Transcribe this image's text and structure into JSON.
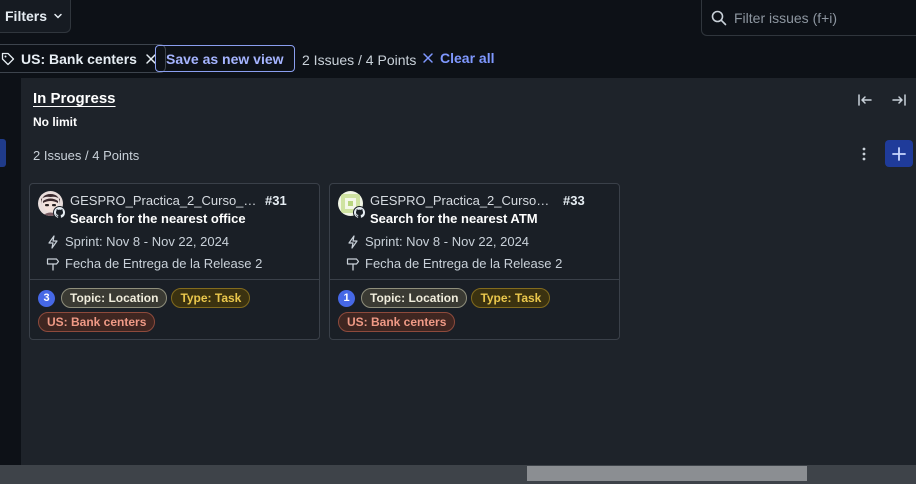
{
  "toolbar": {
    "filters_label": "Filters",
    "search_placeholder": "Filter issues (f+i)"
  },
  "filter_bar": {
    "active_filter_label": "US: Bank centers",
    "save_view_label": "Save as new view",
    "count_text": "2 Issues / 4 Points",
    "clear_all_label": "Clear all"
  },
  "column": {
    "title": "In Progress",
    "limit": "No limit",
    "count_text": "2 Issues / 4 Points"
  },
  "cards": [
    {
      "repo": "GESPRO_Practica_2_Curso_202...",
      "number": "#31",
      "title": "Search for the nearest office",
      "sprint": "Sprint: Nov 8 - Nov 22, 2024",
      "milestone": "Fecha de Entrega de la Release 2",
      "points": "3",
      "labels": [
        "Topic: Location",
        "Type: Task",
        "US: Bank centers"
      ]
    },
    {
      "repo": "GESPRO_Practica_2_Curso_20...",
      "number": "#33",
      "title": "Search for the nearest ATM",
      "sprint": "Sprint: Nov 8 - Nov 22, 2024",
      "milestone": "Fecha de Entrega de la Release 2",
      "points": "1",
      "labels": [
        "Topic: Location",
        "Type: Task",
        "US: Bank centers"
      ]
    }
  ],
  "icons": {
    "filters": "chevron-down-icon",
    "search": "search-icon",
    "filter_tag": "tag-icon",
    "remove_filter": "close-icon",
    "clear_all": "close-icon",
    "collapse_left": "collapse-left-icon",
    "collapse_right": "collapse-right-icon",
    "column_menu": "kebab-icon",
    "add_item": "plus-icon",
    "sprint": "lightning-icon",
    "milestone": "milestone-icon",
    "github": "github-icon"
  },
  "colors": {
    "background": "#0d1117",
    "column_bg": "#1e232a",
    "accent": "#4668e6",
    "topic_label": "#8f8f7c",
    "type_label": "#eac74c",
    "us_label": "#ef9a86"
  }
}
